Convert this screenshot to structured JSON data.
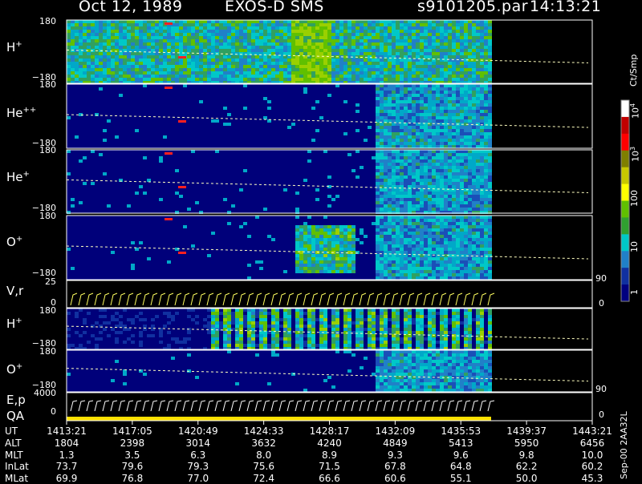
{
  "header": {
    "date": "Oct 12, 1989",
    "instrument": "EXOS-D SMS",
    "file": "s9101205.par",
    "time": "14:13:21"
  },
  "panels": [
    {
      "id": "H+",
      "label": "H",
      "sup": "+",
      "top_tick": "180",
      "bottom_tick": "−180"
    },
    {
      "id": "He++",
      "label": "He",
      "sup": "++",
      "top_tick": "180",
      "bottom_tick": "−180"
    },
    {
      "id": "He+",
      "label": "He",
      "sup": "+",
      "top_tick": "180",
      "bottom_tick": "−180"
    },
    {
      "id": "O+",
      "label": "O",
      "sup": "+",
      "top_tick": "180",
      "bottom_tick": "−180"
    },
    {
      "id": "Vr",
      "label": "V,r",
      "sup": "",
      "top_tick": "25",
      "bottom_tick": "0",
      "right_top": "90",
      "right_bottom": "0"
    },
    {
      "id": "H+2",
      "label": "H",
      "sup": "+",
      "top_tick": "180",
      "bottom_tick": "−180"
    },
    {
      "id": "O+2",
      "label": "O",
      "sup": "+",
      "top_tick": "180",
      "bottom_tick": "−180",
      "right_bottom": "90"
    },
    {
      "id": "Ep",
      "label": "E,p",
      "sup": "",
      "top_tick": "4000",
      "bottom_tick": "0",
      "right_bottom": "0",
      "label2": "QA"
    }
  ],
  "colorbar": {
    "unit": "Ct/Smp",
    "ticks": [
      "10",
      "100",
      "10",
      "10",
      "1"
    ],
    "tick_exps": [
      "4",
      "",
      "3",
      "",
      ""
    ],
    "colors": [
      "#ffffff",
      "#c00000",
      "#ff0000",
      "#7f7f00",
      "#c8c800",
      "#ffff00",
      "#60c000",
      "#30a030",
      "#00c8c8",
      "#2080c8",
      "#1030a0",
      "#000080"
    ]
  },
  "ut_table": {
    "labels": [
      "UT",
      "ALT",
      "MLT",
      "InLat",
      "MLat"
    ],
    "columns": [
      [
        "1413:21",
        "1804",
        "1.3",
        "73.7",
        "69.9"
      ],
      [
        "1417:05",
        "2398",
        "3.5",
        "79.6",
        "76.8"
      ],
      [
        "1420:49",
        "3014",
        "6.3",
        "79.3",
        "77.0"
      ],
      [
        "1424:33",
        "3632",
        "8.0",
        "75.6",
        "72.4"
      ],
      [
        "1428:17",
        "4240",
        "8.9",
        "71.5",
        "66.6"
      ],
      [
        "1432:09",
        "4849",
        "9.3",
        "67.8",
        "60.6"
      ],
      [
        "1435:53",
        "5413",
        "9.6",
        "64.8",
        "55.1"
      ],
      [
        "1439:37",
        "5950",
        "9.8",
        "62.2",
        "50.0"
      ],
      [
        "1443:21",
        "6456",
        "10.0",
        "60.2",
        "45.3"
      ]
    ]
  },
  "footer": {
    "stamp": "Sep-00  2AA32L"
  },
  "chart_data": {
    "type": "heatmap",
    "title": "Oct 12, 1989   EXOS-D SMS",
    "x_ticks": [
      "1413:21",
      "1417:05",
      "1420:49",
      "1424:33",
      "1428:17",
      "1432:09",
      "1435:53",
      "1439:37",
      "1443:21"
    ],
    "panels": [
      "H+",
      "He++",
      "He+",
      "O+",
      "V,r",
      "H+",
      "O+",
      "E,p / QA"
    ],
    "pitch_angle_range": [
      -180,
      180
    ],
    "colorbar_range_cts": [
      1,
      10000
    ],
    "colorbar_scale": "log"
  }
}
